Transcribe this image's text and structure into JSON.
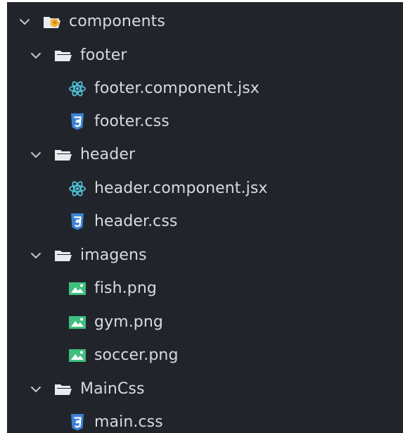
{
  "tree": {
    "root": {
      "label": "components",
      "icon": "folder-components-open-icon",
      "expanded": true
    },
    "footer": {
      "label": "footer",
      "icon": "folder-open-icon",
      "expanded": true
    },
    "footer_jsx": {
      "label": "footer.component.jsx",
      "icon": "react-icon"
    },
    "footer_css": {
      "label": "footer.css",
      "icon": "css3-icon"
    },
    "header": {
      "label": "header",
      "icon": "folder-open-icon",
      "expanded": true
    },
    "header_jsx": {
      "label": "header.component.jsx",
      "icon": "react-icon"
    },
    "header_css": {
      "label": "header.css",
      "icon": "css3-icon"
    },
    "imagens": {
      "label": "imagens",
      "icon": "folder-open-icon",
      "expanded": true
    },
    "fish": {
      "label": "fish.png",
      "icon": "image-icon"
    },
    "gym": {
      "label": "gym.png",
      "icon": "image-icon"
    },
    "soccer": {
      "label": "soccer.png",
      "icon": "image-icon"
    },
    "maincss_folder": {
      "label": "MainCss",
      "icon": "folder-open-icon",
      "expanded": true
    },
    "main_css": {
      "label": "main.css",
      "icon": "css3-icon"
    }
  },
  "colors": {
    "background": "#21252b",
    "text": "#d7dae0",
    "chevron": "#c5c8ce",
    "folder": "#e8ecef",
    "folder_accent": "#f2b233",
    "react": "#4fc3d9",
    "css3": "#3b82d6",
    "image": "#3fbf7f"
  }
}
